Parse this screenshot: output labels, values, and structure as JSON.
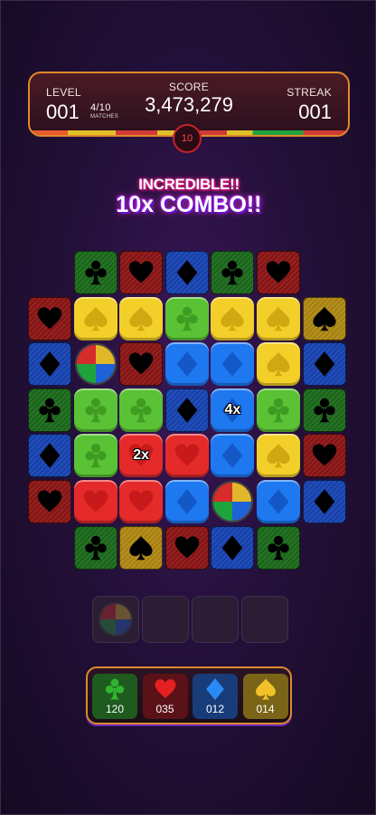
{
  "hud": {
    "level_label": "LEVEL",
    "level": "001",
    "matches": "4/10",
    "matches_label": "MATCHES",
    "score_label": "SCORE",
    "score": "3,473,279",
    "streak_label": "STREAK",
    "streak": "001",
    "timer": "10"
  },
  "combo": {
    "line1": "INCREDIBLE!!",
    "line2": "10x COMBO!!"
  },
  "board": {
    "rows": [
      [
        "",
        "club-d",
        "heart-d",
        "diamond-d",
        "club-d",
        "heart-d",
        ""
      ],
      [
        "heart-d",
        "spade-b",
        "spade-b",
        "club-b",
        "spade-b",
        "spade-b",
        "spade-d"
      ],
      [
        "diamond-d",
        "wheel",
        "heart-d",
        "diamond-b",
        "diamond-b",
        "spade-b",
        "diamond-d"
      ],
      [
        "club-d",
        "club-b",
        "club-b",
        "diamond-d",
        "diamond-b:4x",
        "club-b",
        "club-d"
      ],
      [
        "diamond-d",
        "club-b",
        "heart-b:2x",
        "heart-b",
        "diamond-b",
        "spade-b",
        "heart-d"
      ],
      [
        "heart-d",
        "heart-b",
        "heart-b",
        "diamond-b",
        "wheel",
        "diamond-b",
        "diamond-d"
      ],
      [
        "",
        "club-d",
        "spade-d",
        "heart-d",
        "diamond-d",
        "club-d",
        ""
      ]
    ]
  },
  "slots": [
    "wheel",
    "",
    "",
    ""
  ],
  "tray": [
    {
      "suit": "club",
      "icon": "club-icon",
      "count": "120",
      "color": "#1f5a1f"
    },
    {
      "suit": "heart",
      "icon": "heart-icon",
      "count": "035",
      "color": "#5a1218"
    },
    {
      "suit": "diamond",
      "icon": "diamond-icon",
      "count": "012",
      "color": "#183c7a"
    },
    {
      "suit": "spade",
      "icon": "spade-icon",
      "count": "014",
      "color": "#7a6418"
    }
  ]
}
